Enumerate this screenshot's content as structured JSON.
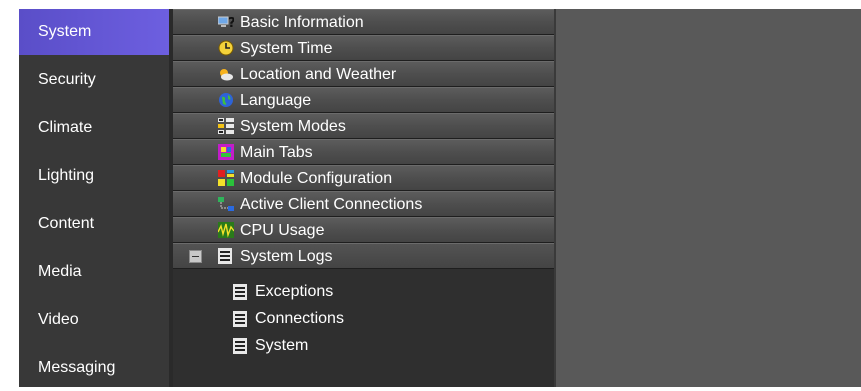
{
  "sidebar": {
    "items": [
      {
        "label": "System",
        "active": true
      },
      {
        "label": "Security"
      },
      {
        "label": "Climate"
      },
      {
        "label": "Lighting"
      },
      {
        "label": "Content"
      },
      {
        "label": "Media"
      },
      {
        "label": "Video"
      },
      {
        "label": "Messaging"
      }
    ]
  },
  "tree": {
    "items": [
      {
        "label": "Basic Information",
        "icon": "computer-question-icon"
      },
      {
        "label": "System Time",
        "icon": "clock-icon"
      },
      {
        "label": "Location and Weather",
        "icon": "weather-icon"
      },
      {
        "label": "Language",
        "icon": "globe-icon"
      },
      {
        "label": "System Modes",
        "icon": "modes-icon"
      },
      {
        "label": "Main Tabs",
        "icon": "tabs-icon"
      },
      {
        "label": "Module Configuration",
        "icon": "modules-icon"
      },
      {
        "label": "Active Client Connections",
        "icon": "connections-icon"
      },
      {
        "label": "CPU Usage",
        "icon": "cpu-graph-icon"
      },
      {
        "label": "System Logs",
        "icon": "log-icon",
        "expanded": true
      }
    ],
    "children": [
      {
        "label": "Exceptions",
        "icon": "log-icon"
      },
      {
        "label": "Connections",
        "icon": "log-icon"
      },
      {
        "label": "System",
        "icon": "log-icon"
      }
    ]
  },
  "colors": {
    "active_item": "#6a5de0",
    "sidebar_bg": "#383838",
    "tree_bg": "#2f2f2f",
    "content_bg": "#595959"
  }
}
